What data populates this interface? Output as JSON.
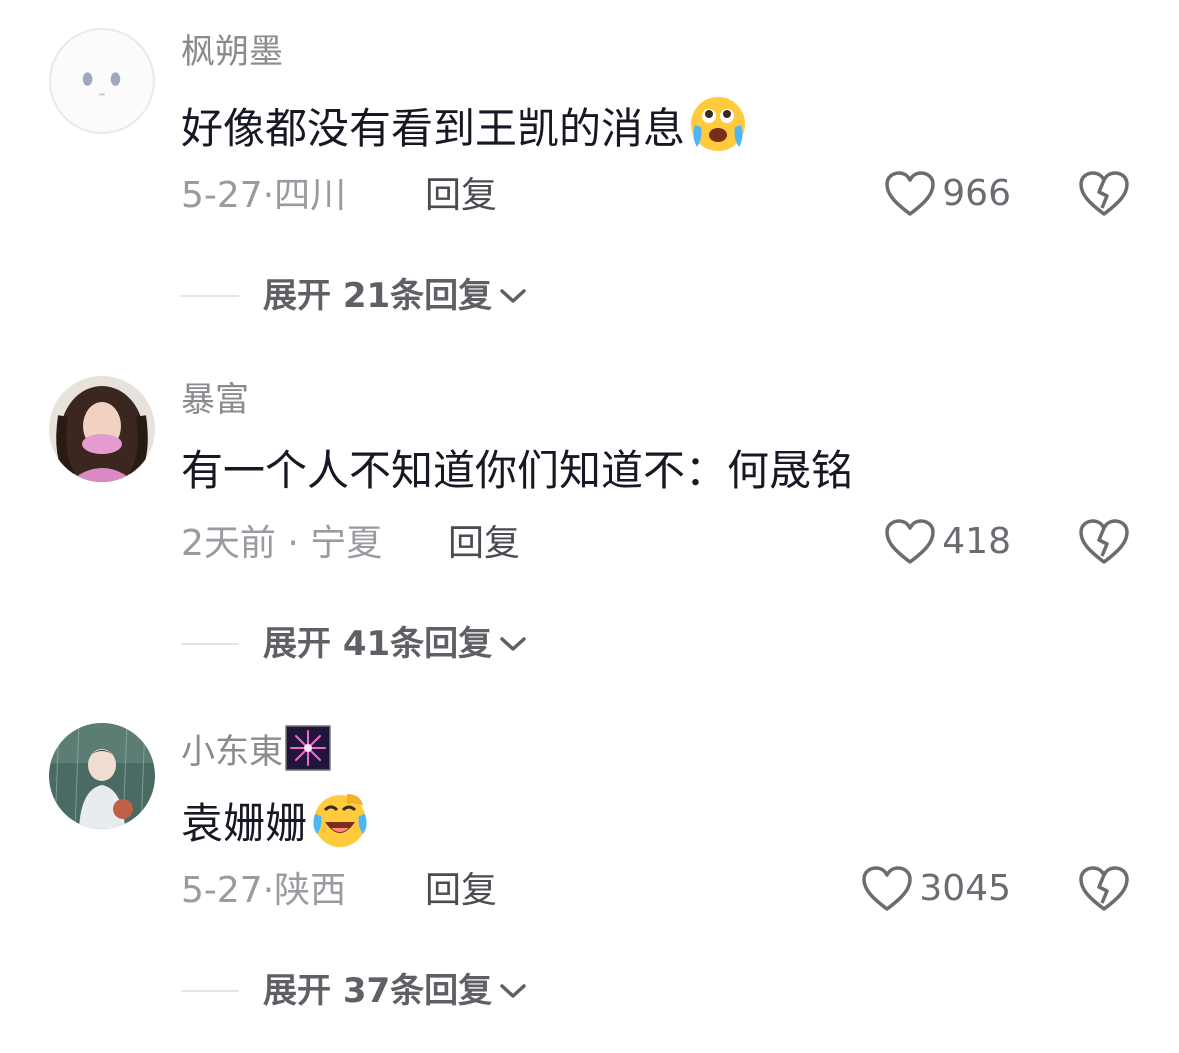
{
  "comments": [
    {
      "username": "枫朔墨",
      "text": "好像都没有看到王凯的消息",
      "emoji": "crying-face-emoji",
      "time": "5-27·",
      "location": "四川",
      "reply_label": "回复",
      "likes": "966",
      "expand_label": "展开 21条回复"
    },
    {
      "username": "暴富",
      "text": "有一个人不知道你们知道不：何晟铭",
      "time": "2天前 ·",
      "location": "宁夏",
      "reply_label": "回复",
      "likes": "418",
      "expand_label": "展开 41条回复"
    },
    {
      "username": "小东東",
      "badge": "fireworks-icon",
      "text": "袁姗姗",
      "emoji": "laugh-cry-emoji",
      "time": "5-27·",
      "location": "陕西",
      "reply_label": "回复",
      "likes": "3045",
      "expand_label": "展开 37条回复"
    }
  ],
  "colors": {
    "text_primary": "#161823",
    "text_secondary": "#8a8a8f",
    "divider": "#e4e4e6"
  }
}
